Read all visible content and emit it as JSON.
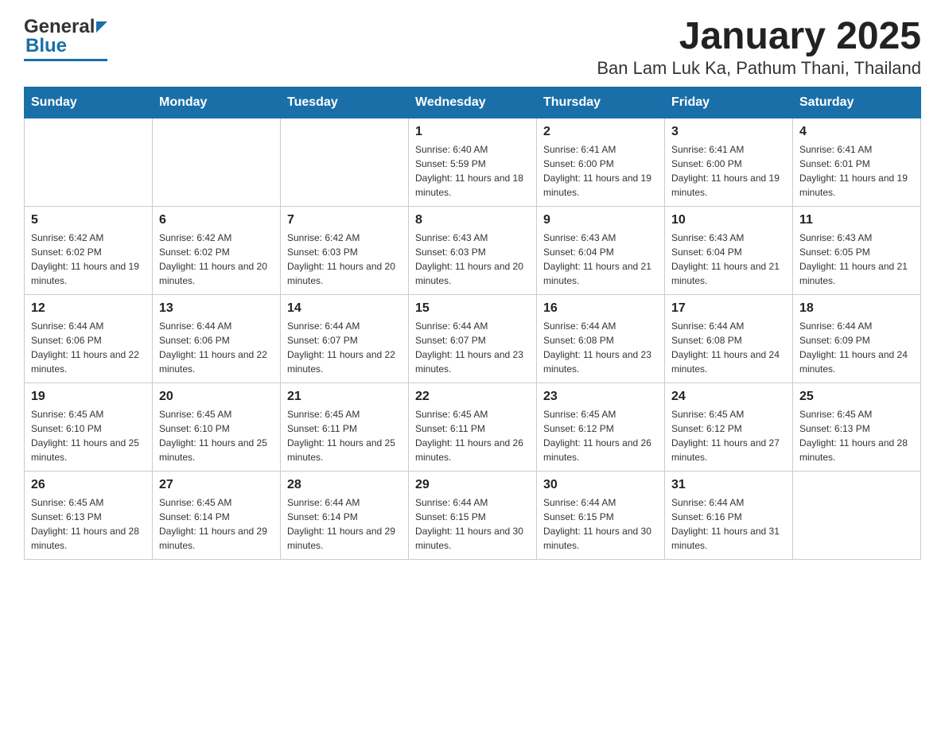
{
  "header": {
    "logo_general": "General",
    "logo_blue": "Blue",
    "title": "January 2025",
    "subtitle": "Ban Lam Luk Ka, Pathum Thani, Thailand"
  },
  "days_of_week": [
    "Sunday",
    "Monday",
    "Tuesday",
    "Wednesday",
    "Thursday",
    "Friday",
    "Saturday"
  ],
  "weeks": [
    [
      {
        "day": "",
        "sunrise": "",
        "sunset": "",
        "daylight": ""
      },
      {
        "day": "",
        "sunrise": "",
        "sunset": "",
        "daylight": ""
      },
      {
        "day": "",
        "sunrise": "",
        "sunset": "",
        "daylight": ""
      },
      {
        "day": "1",
        "sunrise": "Sunrise: 6:40 AM",
        "sunset": "Sunset: 5:59 PM",
        "daylight": "Daylight: 11 hours and 18 minutes."
      },
      {
        "day": "2",
        "sunrise": "Sunrise: 6:41 AM",
        "sunset": "Sunset: 6:00 PM",
        "daylight": "Daylight: 11 hours and 19 minutes."
      },
      {
        "day": "3",
        "sunrise": "Sunrise: 6:41 AM",
        "sunset": "Sunset: 6:00 PM",
        "daylight": "Daylight: 11 hours and 19 minutes."
      },
      {
        "day": "4",
        "sunrise": "Sunrise: 6:41 AM",
        "sunset": "Sunset: 6:01 PM",
        "daylight": "Daylight: 11 hours and 19 minutes."
      }
    ],
    [
      {
        "day": "5",
        "sunrise": "Sunrise: 6:42 AM",
        "sunset": "Sunset: 6:02 PM",
        "daylight": "Daylight: 11 hours and 19 minutes."
      },
      {
        "day": "6",
        "sunrise": "Sunrise: 6:42 AM",
        "sunset": "Sunset: 6:02 PM",
        "daylight": "Daylight: 11 hours and 20 minutes."
      },
      {
        "day": "7",
        "sunrise": "Sunrise: 6:42 AM",
        "sunset": "Sunset: 6:03 PM",
        "daylight": "Daylight: 11 hours and 20 minutes."
      },
      {
        "day": "8",
        "sunrise": "Sunrise: 6:43 AM",
        "sunset": "Sunset: 6:03 PM",
        "daylight": "Daylight: 11 hours and 20 minutes."
      },
      {
        "day": "9",
        "sunrise": "Sunrise: 6:43 AM",
        "sunset": "Sunset: 6:04 PM",
        "daylight": "Daylight: 11 hours and 21 minutes."
      },
      {
        "day": "10",
        "sunrise": "Sunrise: 6:43 AM",
        "sunset": "Sunset: 6:04 PM",
        "daylight": "Daylight: 11 hours and 21 minutes."
      },
      {
        "day": "11",
        "sunrise": "Sunrise: 6:43 AM",
        "sunset": "Sunset: 6:05 PM",
        "daylight": "Daylight: 11 hours and 21 minutes."
      }
    ],
    [
      {
        "day": "12",
        "sunrise": "Sunrise: 6:44 AM",
        "sunset": "Sunset: 6:06 PM",
        "daylight": "Daylight: 11 hours and 22 minutes."
      },
      {
        "day": "13",
        "sunrise": "Sunrise: 6:44 AM",
        "sunset": "Sunset: 6:06 PM",
        "daylight": "Daylight: 11 hours and 22 minutes."
      },
      {
        "day": "14",
        "sunrise": "Sunrise: 6:44 AM",
        "sunset": "Sunset: 6:07 PM",
        "daylight": "Daylight: 11 hours and 22 minutes."
      },
      {
        "day": "15",
        "sunrise": "Sunrise: 6:44 AM",
        "sunset": "Sunset: 6:07 PM",
        "daylight": "Daylight: 11 hours and 23 minutes."
      },
      {
        "day": "16",
        "sunrise": "Sunrise: 6:44 AM",
        "sunset": "Sunset: 6:08 PM",
        "daylight": "Daylight: 11 hours and 23 minutes."
      },
      {
        "day": "17",
        "sunrise": "Sunrise: 6:44 AM",
        "sunset": "Sunset: 6:08 PM",
        "daylight": "Daylight: 11 hours and 24 minutes."
      },
      {
        "day": "18",
        "sunrise": "Sunrise: 6:44 AM",
        "sunset": "Sunset: 6:09 PM",
        "daylight": "Daylight: 11 hours and 24 minutes."
      }
    ],
    [
      {
        "day": "19",
        "sunrise": "Sunrise: 6:45 AM",
        "sunset": "Sunset: 6:10 PM",
        "daylight": "Daylight: 11 hours and 25 minutes."
      },
      {
        "day": "20",
        "sunrise": "Sunrise: 6:45 AM",
        "sunset": "Sunset: 6:10 PM",
        "daylight": "Daylight: 11 hours and 25 minutes."
      },
      {
        "day": "21",
        "sunrise": "Sunrise: 6:45 AM",
        "sunset": "Sunset: 6:11 PM",
        "daylight": "Daylight: 11 hours and 25 minutes."
      },
      {
        "day": "22",
        "sunrise": "Sunrise: 6:45 AM",
        "sunset": "Sunset: 6:11 PM",
        "daylight": "Daylight: 11 hours and 26 minutes."
      },
      {
        "day": "23",
        "sunrise": "Sunrise: 6:45 AM",
        "sunset": "Sunset: 6:12 PM",
        "daylight": "Daylight: 11 hours and 26 minutes."
      },
      {
        "day": "24",
        "sunrise": "Sunrise: 6:45 AM",
        "sunset": "Sunset: 6:12 PM",
        "daylight": "Daylight: 11 hours and 27 minutes."
      },
      {
        "day": "25",
        "sunrise": "Sunrise: 6:45 AM",
        "sunset": "Sunset: 6:13 PM",
        "daylight": "Daylight: 11 hours and 28 minutes."
      }
    ],
    [
      {
        "day": "26",
        "sunrise": "Sunrise: 6:45 AM",
        "sunset": "Sunset: 6:13 PM",
        "daylight": "Daylight: 11 hours and 28 minutes."
      },
      {
        "day": "27",
        "sunrise": "Sunrise: 6:45 AM",
        "sunset": "Sunset: 6:14 PM",
        "daylight": "Daylight: 11 hours and 29 minutes."
      },
      {
        "day": "28",
        "sunrise": "Sunrise: 6:44 AM",
        "sunset": "Sunset: 6:14 PM",
        "daylight": "Daylight: 11 hours and 29 minutes."
      },
      {
        "day": "29",
        "sunrise": "Sunrise: 6:44 AM",
        "sunset": "Sunset: 6:15 PM",
        "daylight": "Daylight: 11 hours and 30 minutes."
      },
      {
        "day": "30",
        "sunrise": "Sunrise: 6:44 AM",
        "sunset": "Sunset: 6:15 PM",
        "daylight": "Daylight: 11 hours and 30 minutes."
      },
      {
        "day": "31",
        "sunrise": "Sunrise: 6:44 AM",
        "sunset": "Sunset: 6:16 PM",
        "daylight": "Daylight: 11 hours and 31 minutes."
      },
      {
        "day": "",
        "sunrise": "",
        "sunset": "",
        "daylight": ""
      }
    ]
  ]
}
